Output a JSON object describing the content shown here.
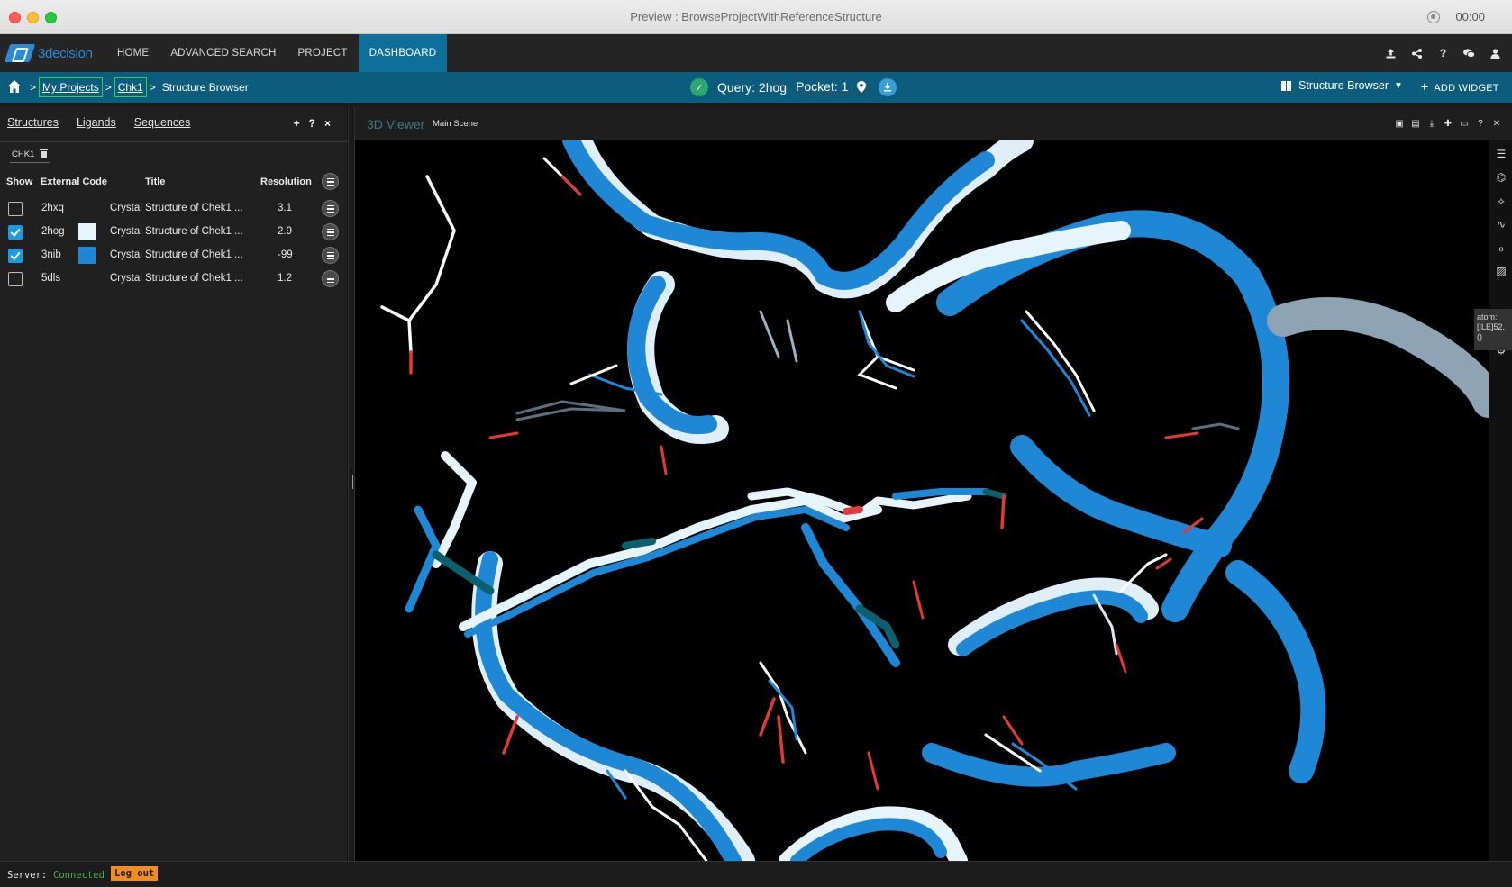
{
  "window": {
    "title": "Preview : BrowseProjectWithReferenceStructure",
    "record_time": "00:00"
  },
  "app": {
    "logo_text": "3decision",
    "nav": [
      "HOME",
      "ADVANCED SEARCH",
      "PROJECT",
      "DASHBOARD"
    ],
    "active_nav": "DASHBOARD",
    "nav_icons": [
      "upload-icon",
      "share-icon",
      "help-icon",
      "chat-icon",
      "user-icon"
    ]
  },
  "breadcrumb": {
    "sep": ">",
    "items": [
      "My Projects",
      "Chk1"
    ],
    "current": "Structure Browser"
  },
  "query": {
    "label": "Query: 2hog",
    "pocket": "Pocket: 1"
  },
  "view_select": {
    "label": "Structure Browser"
  },
  "add_widget": {
    "label": "ADD WIDGET",
    "icon": "+"
  },
  "left_panel": {
    "tabs": [
      "Structures",
      "Ligands",
      "Sequences"
    ],
    "actions": [
      "+",
      "?",
      "×"
    ],
    "tag": "CHK1",
    "columns": {
      "show": "Show",
      "code": "External Code",
      "title": "Title",
      "resolution": "Resolution"
    },
    "rows": [
      {
        "checked": false,
        "code": "2hxq",
        "color": "",
        "title": "Crystal Structure of Chek1 ...",
        "resolution": "3.1"
      },
      {
        "checked": true,
        "code": "2hog",
        "color": "#e6f4fb",
        "title": "Crystal Structure of Chek1 ...",
        "resolution": "2.9"
      },
      {
        "checked": true,
        "code": "3nib",
        "color": "#1e88d6",
        "title": "Crystal Structure of Chek1 ...",
        "resolution": "-99"
      },
      {
        "checked": false,
        "code": "5dls",
        "color": "",
        "title": "Crystal Structure of Chek1 ...",
        "resolution": "1.2"
      }
    ]
  },
  "viewer": {
    "title": "3D Viewer",
    "scene": "Main Scene",
    "tools": [
      "image-icon",
      "save-icon",
      "download-icon",
      "add-icon",
      "screen-icon",
      "help-icon",
      "close-icon"
    ],
    "atom_tooltip": [
      "atom:",
      "[ILE]52.",
      "()"
    ],
    "colors": {
      "structure_a": "#1e88d6",
      "structure_b": "#e6f4fb",
      "oxygen": "#e53935",
      "nitrogen": "#0b5f6e"
    }
  },
  "status": {
    "server_label": "Server:",
    "server_state": "Connected",
    "logout": "Log out"
  }
}
